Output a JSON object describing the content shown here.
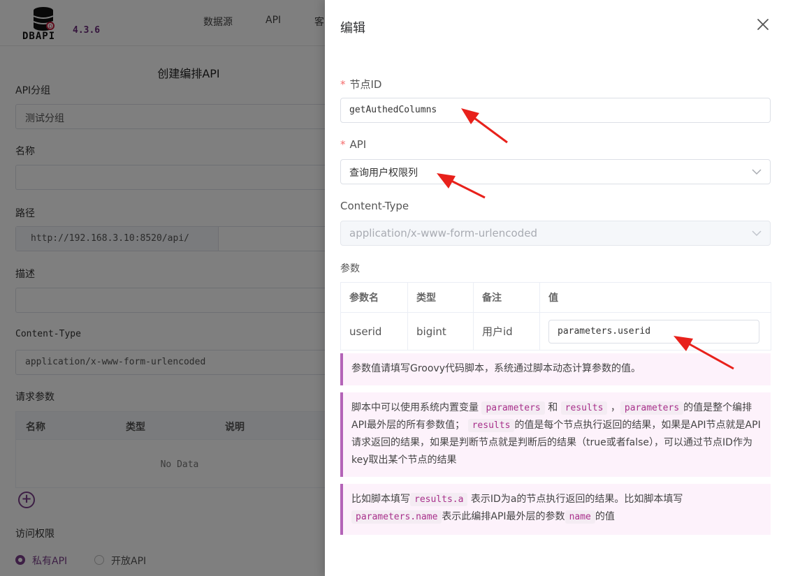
{
  "app": {
    "logo_text": "DBAPI",
    "version": "4.3.6",
    "nav": [
      "数据源",
      "API",
      "客"
    ]
  },
  "form": {
    "title": "创建编排API",
    "group_label": "API分组",
    "group_value": "测试分组",
    "name_label": "名称",
    "path_label": "路径",
    "path_prefix": "http://192.168.3.10:8520/api/",
    "desc_label": "描述",
    "ct_label": "Content-Type",
    "ct_value": "application/x-www-form-urlencoded",
    "params_label": "请求参数",
    "params_cols": [
      "名称",
      "类型",
      "说明"
    ],
    "no_data": "No Data",
    "access_label": "访问权限",
    "private_label": "私有API",
    "public_label": "开放API"
  },
  "drawer": {
    "title": "编辑",
    "node_id_label": "节点ID",
    "node_id_value": "getAuthedColumns",
    "api_label": "API",
    "api_value": "查询用户权限列",
    "ct_label": "Content-Type",
    "ct_placeholder": "application/x-www-form-urlencoded",
    "params_label": "参数",
    "table": {
      "headers": [
        "参数名",
        "类型",
        "备注",
        "值"
      ],
      "rows": [
        {
          "name": "userid",
          "type": "bigint",
          "remark": "用户id",
          "value": "parameters.userid"
        }
      ]
    },
    "tip1": "参数值请填写Groovy代码脚本，系统通过脚本动态计算参数的值。",
    "tip2": {
      "t1": "脚本中可以使用系统内置变量",
      "c1": "parameters",
      "t2": "和",
      "c2": "results",
      "t3": "，",
      "c3": "parameters",
      "t4": "的值是整个编排API最外层的所有参数值；",
      "c4": "results",
      "t5": "的值是每个节点执行返回的结果，如果是API节点就是API请求返回的结果，如果是判断节点就是判断后的结果（true或者false），可以通过节点ID作为key取出某个节点的结果"
    },
    "tip3": {
      "t1": "比如脚本填写",
      "c1": "results.a",
      "t2": "表示ID为a的节点执行返回的结果。比如脚本填写",
      "c2": "parameters.name",
      "t3": "表示此编排API最外层的参数",
      "c3": "name",
      "t4": "的值"
    }
  },
  "colors": {
    "accent": "#7b3f8a",
    "required": "#f56c6c",
    "arrow": "#e8211b"
  }
}
